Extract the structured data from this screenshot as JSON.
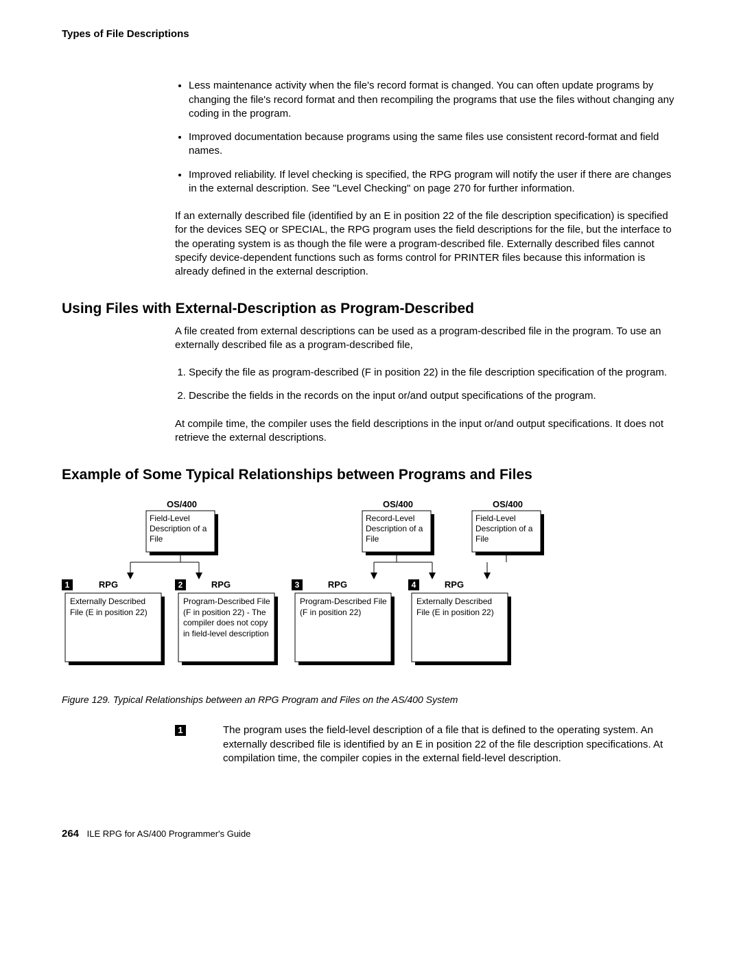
{
  "running_head": "Types of File Descriptions",
  "bullets": [
    "Less maintenance activity when the file's record format is changed.  You can often update programs by changing the file's record format and then recompiling the programs that use the files without changing any coding in the program.",
    "Improved documentation because programs using the same files use consistent record-format and field names.",
    "Improved reliability. If level checking is specified, the RPG program will notify the user if there are changes in the external description. See \"Level Checking\" on page  270 for further information."
  ],
  "para_after_bullets": "If an externally described file (identified by an E in position 22 of the file description specification) is specified for the devices SEQ or SPECIAL, the RPG program uses the field descriptions for the file, but the interface to the operating system is as though the file were a program-described file.  Externally described files cannot specify device-dependent functions such as forms control for PRINTER files because this information is already defined in the external description.",
  "section1_heading": "Using Files with External-Description as Program-Described",
  "section1_intro": "A file created from external descriptions can be used as a program-described file in the program. To use an externally described file as a program-described file,",
  "section1_list": [
    "Specify the file as program-described (F in position 22) in the file description specification of the program.",
    "Describe the fields in the records on the input or/and output specifications of the program."
  ],
  "section1_after": "At compile time, the compiler uses the field descriptions in the input or/and output specifications. It does not retrieve the external descriptions.",
  "section2_heading": "Example of Some Typical Relationships between Programs and Files",
  "figure": {
    "os_labels": [
      "OS/400",
      "OS/400",
      "OS/400"
    ],
    "top_boxes": [
      "Field-Level Description of a File",
      "Record-Level Description of a File",
      "Field-Level Description of a File"
    ],
    "rpg_label": "RPG",
    "nums": [
      "1",
      "2",
      "3",
      "4"
    ],
    "bottom_boxes": [
      "Externally Described File (E in position 22)",
      "Program-Described File (F in position 22) - The compiler does not copy in field-level description",
      "Program-Described File (F in position 22)",
      "Externally Described File (E in position 22)"
    ],
    "caption": "Figure  129.  Typical Relationships between an RPG Program and Files on the AS/400 System"
  },
  "callout": {
    "num": "1",
    "text": "The program uses the field-level description of a file that is defined to the operating system. An externally described file is identified by an E in position 22 of the file description specifications. At compilation time, the compiler copies in the external field-level description."
  },
  "footer": {
    "page_number": "264",
    "book_title": "ILE RPG for AS/400 Programmer's Guide"
  }
}
